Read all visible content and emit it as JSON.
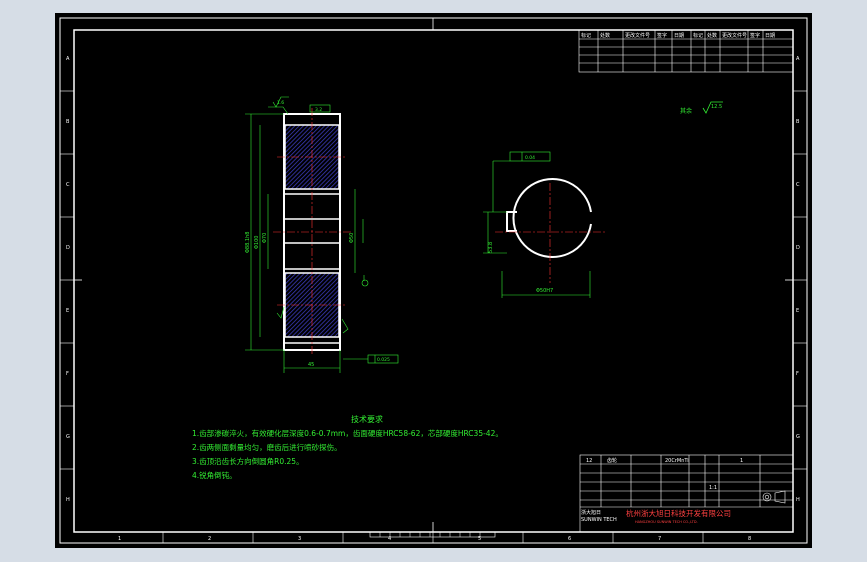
{
  "colors": {
    "background": "#000000",
    "frame": "#ffffff",
    "dimension": "#33ee33",
    "centerline": "#ff3333",
    "hatch": "#4040c0",
    "tech_text": "#33ee33",
    "company": "#ff4040"
  },
  "zone_markers": {
    "left": [
      "A",
      "B",
      "C",
      "D",
      "E",
      "F",
      "G",
      "H"
    ],
    "right": [
      "A",
      "B",
      "C",
      "D",
      "E",
      "F",
      "G",
      "H"
    ],
    "bottom": [
      "1",
      "2",
      "3",
      "4",
      "5",
      "6",
      "7",
      "8"
    ]
  },
  "roughness_note": {
    "label": "其余",
    "value": "12.5"
  },
  "gear_section": {
    "dims": {
      "d1": "Φ88.1h8",
      "d2": "Φ100",
      "d3": "Φ70",
      "d4": "Φ50",
      "width": "45",
      "tol1": "0.025",
      "rough1": "1.6",
      "rough2": "3.2"
    }
  },
  "hub_view": {
    "dims": {
      "bore": "Φ50H7",
      "key": "14",
      "keyway_depth": "53.8",
      "tol": "0.04"
    }
  },
  "tech_requirements": {
    "title": "技术要求",
    "lines": [
      "1.齿部渗碳淬火，有效硬化层深度0.6-0.7mm，齿面硬度HRC58-62，芯部硬度HRC35-42。",
      "2.齿两侧面剩量均匀，磨齿后进行喷砂探伤。",
      "3.齿顶沿齿长方向倒圆角R0.25。",
      "4.锐角倒钝。"
    ]
  },
  "title_block": {
    "part_name": "齿轮",
    "material": "20CrMnTi",
    "scale": "1:1",
    "sheet": "1",
    "drawing_no": "12",
    "company": "杭州浙大旭日科技开发有限公司",
    "company_en": "HANGZHOU SUNWIN TECH CO.,LTD.",
    "left_label": "浙大旭日",
    "left_label_en": "SUNWIN TECH"
  },
  "revision_table": {
    "headers": [
      "标记",
      "处数",
      "更改文件号",
      "签字",
      "日期",
      "标记",
      "处数",
      "更改文件号",
      "签字",
      "日期"
    ]
  }
}
